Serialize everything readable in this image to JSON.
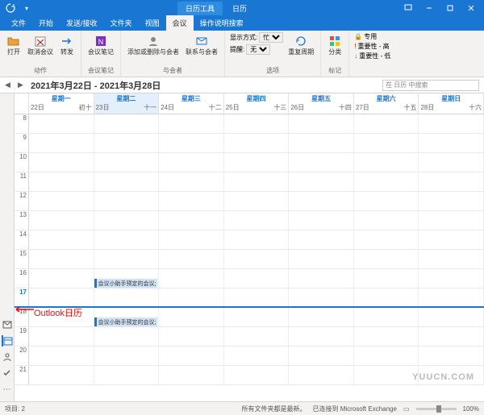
{
  "title_bar": {
    "context_tab": "日历工具",
    "app_tab": "日历"
  },
  "ribbon_tabs": [
    "文件",
    "开始",
    "发送/接收",
    "文件夹",
    "视图",
    "会议",
    "操作说明搜索"
  ],
  "ribbon_active": "会议",
  "ribbon": {
    "group1": {
      "open": "打开",
      "cancel": "取消会议",
      "forward": "转发",
      "label": "动作"
    },
    "group2": {
      "onenote": "会议笔记",
      "label": "会议笔记"
    },
    "group3": {
      "add_remove": "添加或删除与会者",
      "contact": "联系与会者",
      "label": "与会者"
    },
    "group4": {
      "show_as": "显示方式:",
      "show_as_val": "忙",
      "reminder": "提醒:",
      "reminder_val": "无",
      "recur": "重复周期",
      "label": "选项"
    },
    "group5": {
      "categorize": "分类",
      "label": "标记"
    },
    "group6": {
      "private": "专用",
      "high": "重要性 - 高",
      "low": "重要性 - 低"
    }
  },
  "date_range": "2021年3月22日 - 2021年3月28日",
  "search_placeholder": "在 日历 中搜索",
  "days": [
    {
      "name": "星期一",
      "date": "22日",
      "lunar": "初十"
    },
    {
      "name": "星期二",
      "date": "23日",
      "lunar": "十一"
    },
    {
      "name": "星期三",
      "date": "24日",
      "lunar": "十二"
    },
    {
      "name": "星期四",
      "date": "25日",
      "lunar": "十三"
    },
    {
      "name": "星期五",
      "date": "26日",
      "lunar": "十四"
    },
    {
      "name": "星期六",
      "date": "27日",
      "lunar": "十五"
    },
    {
      "name": "星期日",
      "date": "28日",
      "lunar": "十六"
    }
  ],
  "hours": [
    "8",
    "9",
    "10",
    "11",
    "12",
    "13",
    "14",
    "15",
    "16",
    "17",
    "18",
    "19",
    "20",
    "21"
  ],
  "current_hour": "17",
  "events": [
    {
      "title": "会议小助手预定的会议; http",
      "day": 1,
      "hour_idx": 8
    },
    {
      "title": "会议小助手预定的会议; http",
      "day": 1,
      "hour_idx": 10
    }
  ],
  "annotation": "Outlook日历",
  "status": {
    "items": "项目: 2",
    "reminder": "所有文件夹都是最新。",
    "connected": "已连接到 Microsoft Exchange",
    "zoom": "100%"
  },
  "watermark": "YUUCN.COM"
}
